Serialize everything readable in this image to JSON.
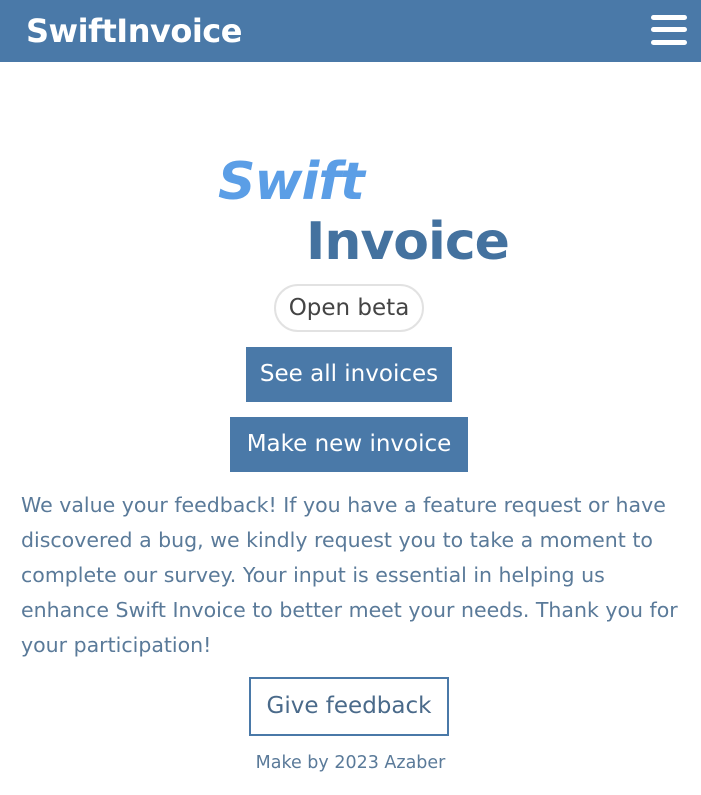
{
  "navbar": {
    "brand": "SwiftInvoice",
    "menu_icon": "hamburger-menu-icon",
    "background_color": "#4a79a8"
  },
  "logo": {
    "line1": "Swift",
    "line2": "Invoice",
    "line1_color": "#5b9ee6",
    "line2_color": "#44729f"
  },
  "badge": {
    "label": "Open beta"
  },
  "actions": {
    "see_all_label": "See all invoices",
    "make_new_label": "Make new invoice",
    "button_color": "#4a79a8"
  },
  "feedback": {
    "message": "We value your feedback! If you have a feature request or have discovered a bug, we kindly request you to take a moment to complete our survey. Your input is essential in helping us enhance Swift Invoice to better meet your needs. Thank you for your participation!",
    "button_label": "Give feedback"
  },
  "footer": {
    "text": "Make by 2023 Azaber"
  }
}
